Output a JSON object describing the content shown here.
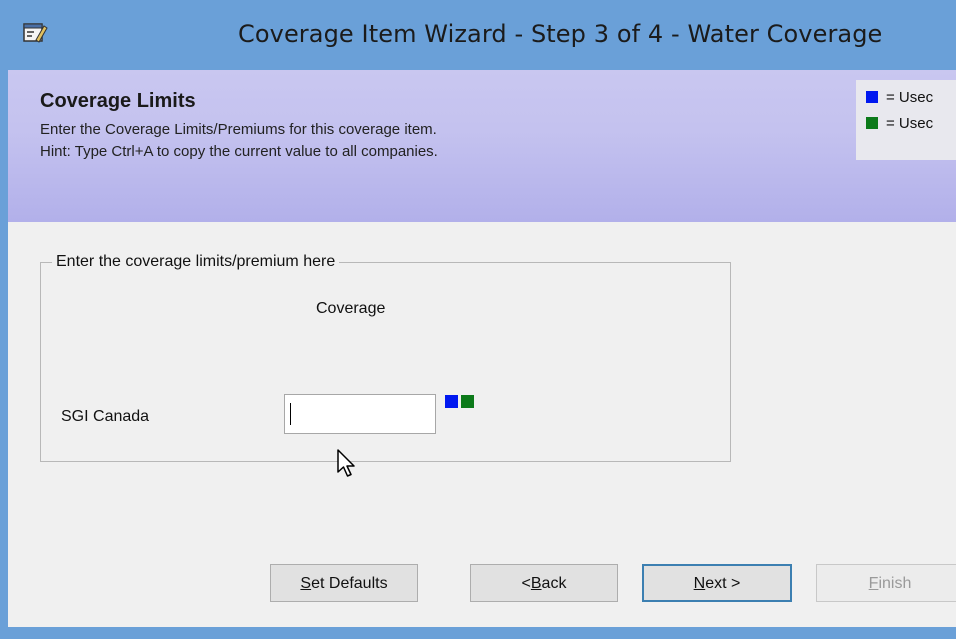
{
  "window": {
    "title": "Coverage Item Wizard - Step 3 of 4 - Water Coverage",
    "icon": "wizard-properties-icon"
  },
  "header": {
    "title": "Coverage Limits",
    "line1": "Enter the Coverage Limits/Premiums for this coverage item.",
    "line2": "Hint: Type Ctrl+A to copy the current value to all companies."
  },
  "legend": [
    {
      "color": "#0018f0",
      "text": "= Usec"
    },
    {
      "color": "#0c7a1a",
      "text": "= Usec"
    }
  ],
  "group": {
    "caption": "Enter the coverage limits/premium here",
    "column_header": "Coverage",
    "rows": [
      {
        "label": "SGI Canada",
        "value": "",
        "marks": [
          "#0018f0",
          "#0c7a1a"
        ]
      }
    ]
  },
  "buttons": {
    "set_defaults": {
      "mnemonic": "S",
      "rest": "et Defaults"
    },
    "back": {
      "prefix": "<",
      "mnemonic": "B",
      "rest": "ack"
    },
    "next": {
      "mnemonic": "N",
      "rest": "ext >"
    },
    "finish": {
      "mnemonic": "F",
      "rest": "inish"
    }
  }
}
